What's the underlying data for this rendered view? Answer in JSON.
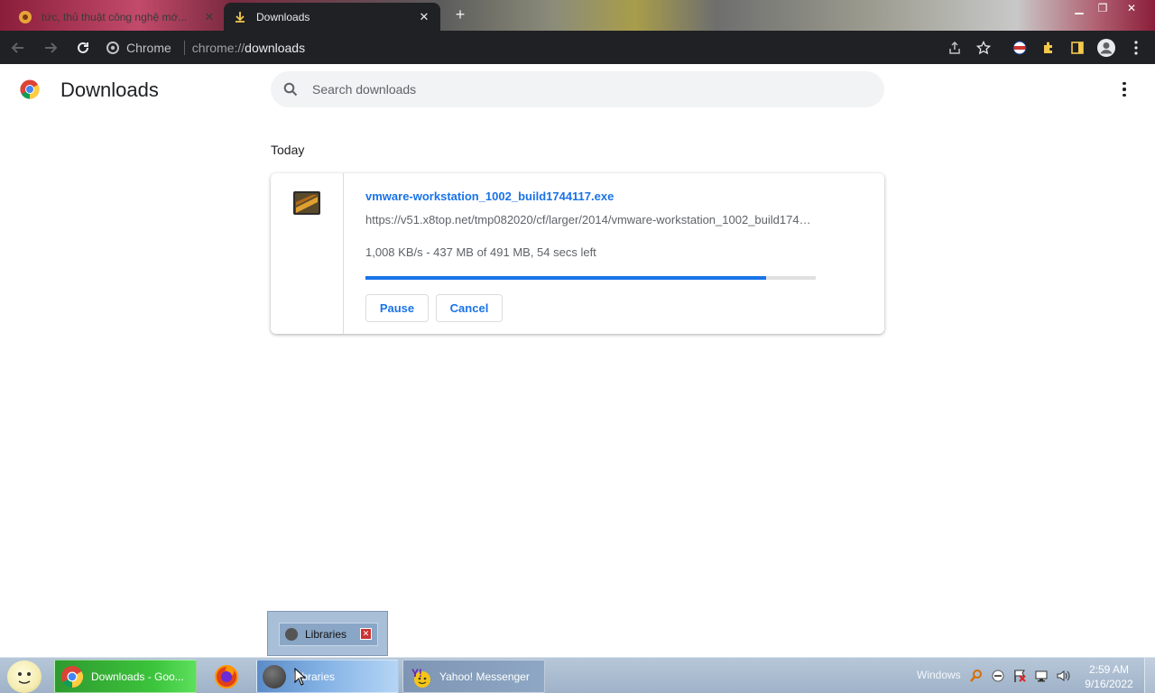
{
  "browser": {
    "tabs": [
      {
        "title": "tức, thủ thuật công nghệ mớ...",
        "active": false
      },
      {
        "title": "Downloads",
        "active": true
      }
    ],
    "omnibox": {
      "chip_label": "Chrome",
      "url_scheme": "chrome://",
      "url_path": "downloads"
    }
  },
  "page": {
    "title": "Downloads",
    "search": {
      "placeholder": "Search downloads",
      "value": ""
    },
    "section_date": "Today",
    "download": {
      "file_name": "vmware-workstation_1002_build1744117.exe",
      "url": "https://v51.x8top.net/tmp082020/cf/larger/2014/vmware-workstation_1002_build1744117.exe",
      "status": "1,008 KB/s - 437 MB of 491 MB, 54 secs left",
      "progress_fraction": 0.89,
      "pause_label": "Pause",
      "cancel_label": "Cancel"
    }
  },
  "taskbar": {
    "popup_label": "Libraries",
    "items": [
      {
        "label": "Downloads - Goo...",
        "icon": "chrome-icon"
      },
      {
        "label": "",
        "icon": "firefox-icon"
      },
      {
        "label": "Libraries",
        "icon": "libraries-icon"
      },
      {
        "label": "Yahoo! Messenger",
        "icon": "yahoo-messenger-icon"
      }
    ],
    "tray_label": "Windows",
    "clock_time": "2:59 AM",
    "clock_date": "9/16/2022"
  },
  "colors": {
    "accent": "#1a73e8",
    "toolbar_bg": "#202124",
    "progress_track": "#e0e0e0"
  }
}
